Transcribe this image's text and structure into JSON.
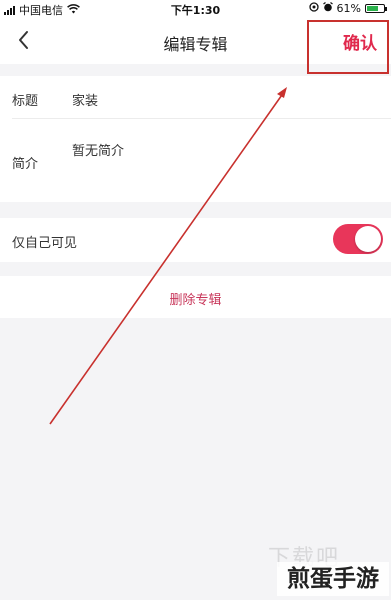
{
  "status_bar": {
    "carrier": "中国电信",
    "time": "下午1:30",
    "battery_pct": "61%"
  },
  "nav": {
    "title": "编辑专辑",
    "confirm_label": "确认"
  },
  "form": {
    "title_label": "标题",
    "title_value": "家装",
    "intro_label": "简介",
    "intro_value": "暂无简介"
  },
  "privacy": {
    "label": "仅自己可见",
    "enabled": true
  },
  "delete_label": "删除专辑",
  "watermark": {
    "faint_text": "下载吧",
    "brand_text": "煎蛋手游"
  },
  "colors": {
    "accent": "#e0294d",
    "toggle_on": "#e8365a",
    "annotation": "#c8312e"
  }
}
